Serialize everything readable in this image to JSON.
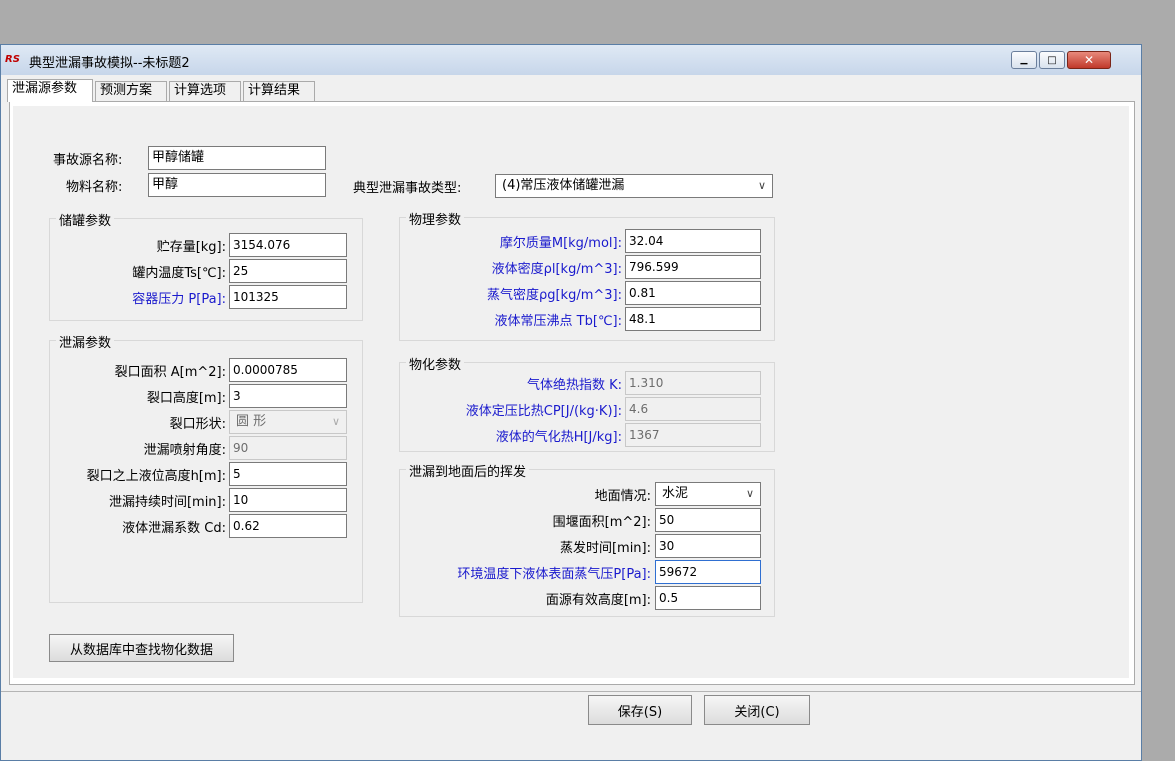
{
  "window": {
    "app_icon": "RS",
    "title": "典型泄漏事故模拟--未标题2",
    "controls": {
      "minimize": "▁",
      "maximize": "□",
      "close": "✕"
    }
  },
  "tabs": [
    "泄漏源参数",
    "预测方案",
    "计算选项",
    "计算结果"
  ],
  "source": {
    "name_label": "事故源名称:",
    "name_value": "甲醇储罐",
    "material_label": "物料名称:",
    "material_value": "甲醇",
    "type_label": "典型泄漏事故类型:",
    "type_value": "(4)常压液体储罐泄漏"
  },
  "tank": {
    "title": "储罐参数",
    "storage_label": "贮存量[kg]:",
    "storage_value": "3154.076",
    "temp_label": "罐内温度Ts[℃]:",
    "temp_value": "25",
    "pressure_label": "容器压力 P[Pa]:",
    "pressure_value": "101325"
  },
  "leak": {
    "title": "泄漏参数",
    "area_label": "裂口面积 A[m^2]:",
    "area_value": "0.0000785",
    "height_label": "裂口高度[m]:",
    "height_value": "3",
    "shape_label": "裂口形状:",
    "shape_value": "圆 形",
    "angle_label": "泄漏喷射角度:",
    "angle_value": "90",
    "liquid_height_label": "裂口之上液位高度h[m]:",
    "liquid_height_value": "5",
    "duration_label": "泄漏持续时间[min]:",
    "duration_value": "10",
    "cd_label": "液体泄漏系数 Cd:",
    "cd_value": "0.62"
  },
  "physical": {
    "title": "物理参数",
    "molar_label": "摩尔质量M[kg/mol]:",
    "molar_value": "32.04",
    "liq_density_label": "液体密度ρl[kg/m^3]:",
    "liq_density_value": "796.599",
    "vap_density_label": "蒸气密度ρg[kg/m^3]:",
    "vap_density_value": "0.81",
    "boiling_label": "液体常压沸点 Tb[℃]:",
    "boiling_value": "48.1"
  },
  "chem": {
    "title": "物化参数",
    "k_label": "气体绝热指数 K:",
    "k_value": "1.310",
    "cp_label": "液体定压比热CP[J/(kg·K)]:",
    "cp_value": "4.6",
    "h_label": "液体的气化热H[J/kg]:",
    "h_value": "1367"
  },
  "ground": {
    "title": "泄漏到地面后的挥发",
    "surface_label": "地面情况:",
    "surface_value": "水泥",
    "dike_label": "围堰面积[m^2]:",
    "dike_value": "50",
    "evap_label": "蒸发时间[min]:",
    "evap_value": "30",
    "vp_label": "环境温度下液体表面蒸气压P[Pa]:",
    "vp_value": "59672",
    "src_height_label": "面源有效高度[m]:",
    "src_height_value": "0.5"
  },
  "buttons": {
    "lookup": "从数据库中查找物化数据",
    "save": "保存(S)",
    "close": "关闭(C)"
  },
  "colors": {
    "field_label_blue": "#1a1acd",
    "title_gradient": "#c7d6ea",
    "close_red": "#c0392b"
  }
}
